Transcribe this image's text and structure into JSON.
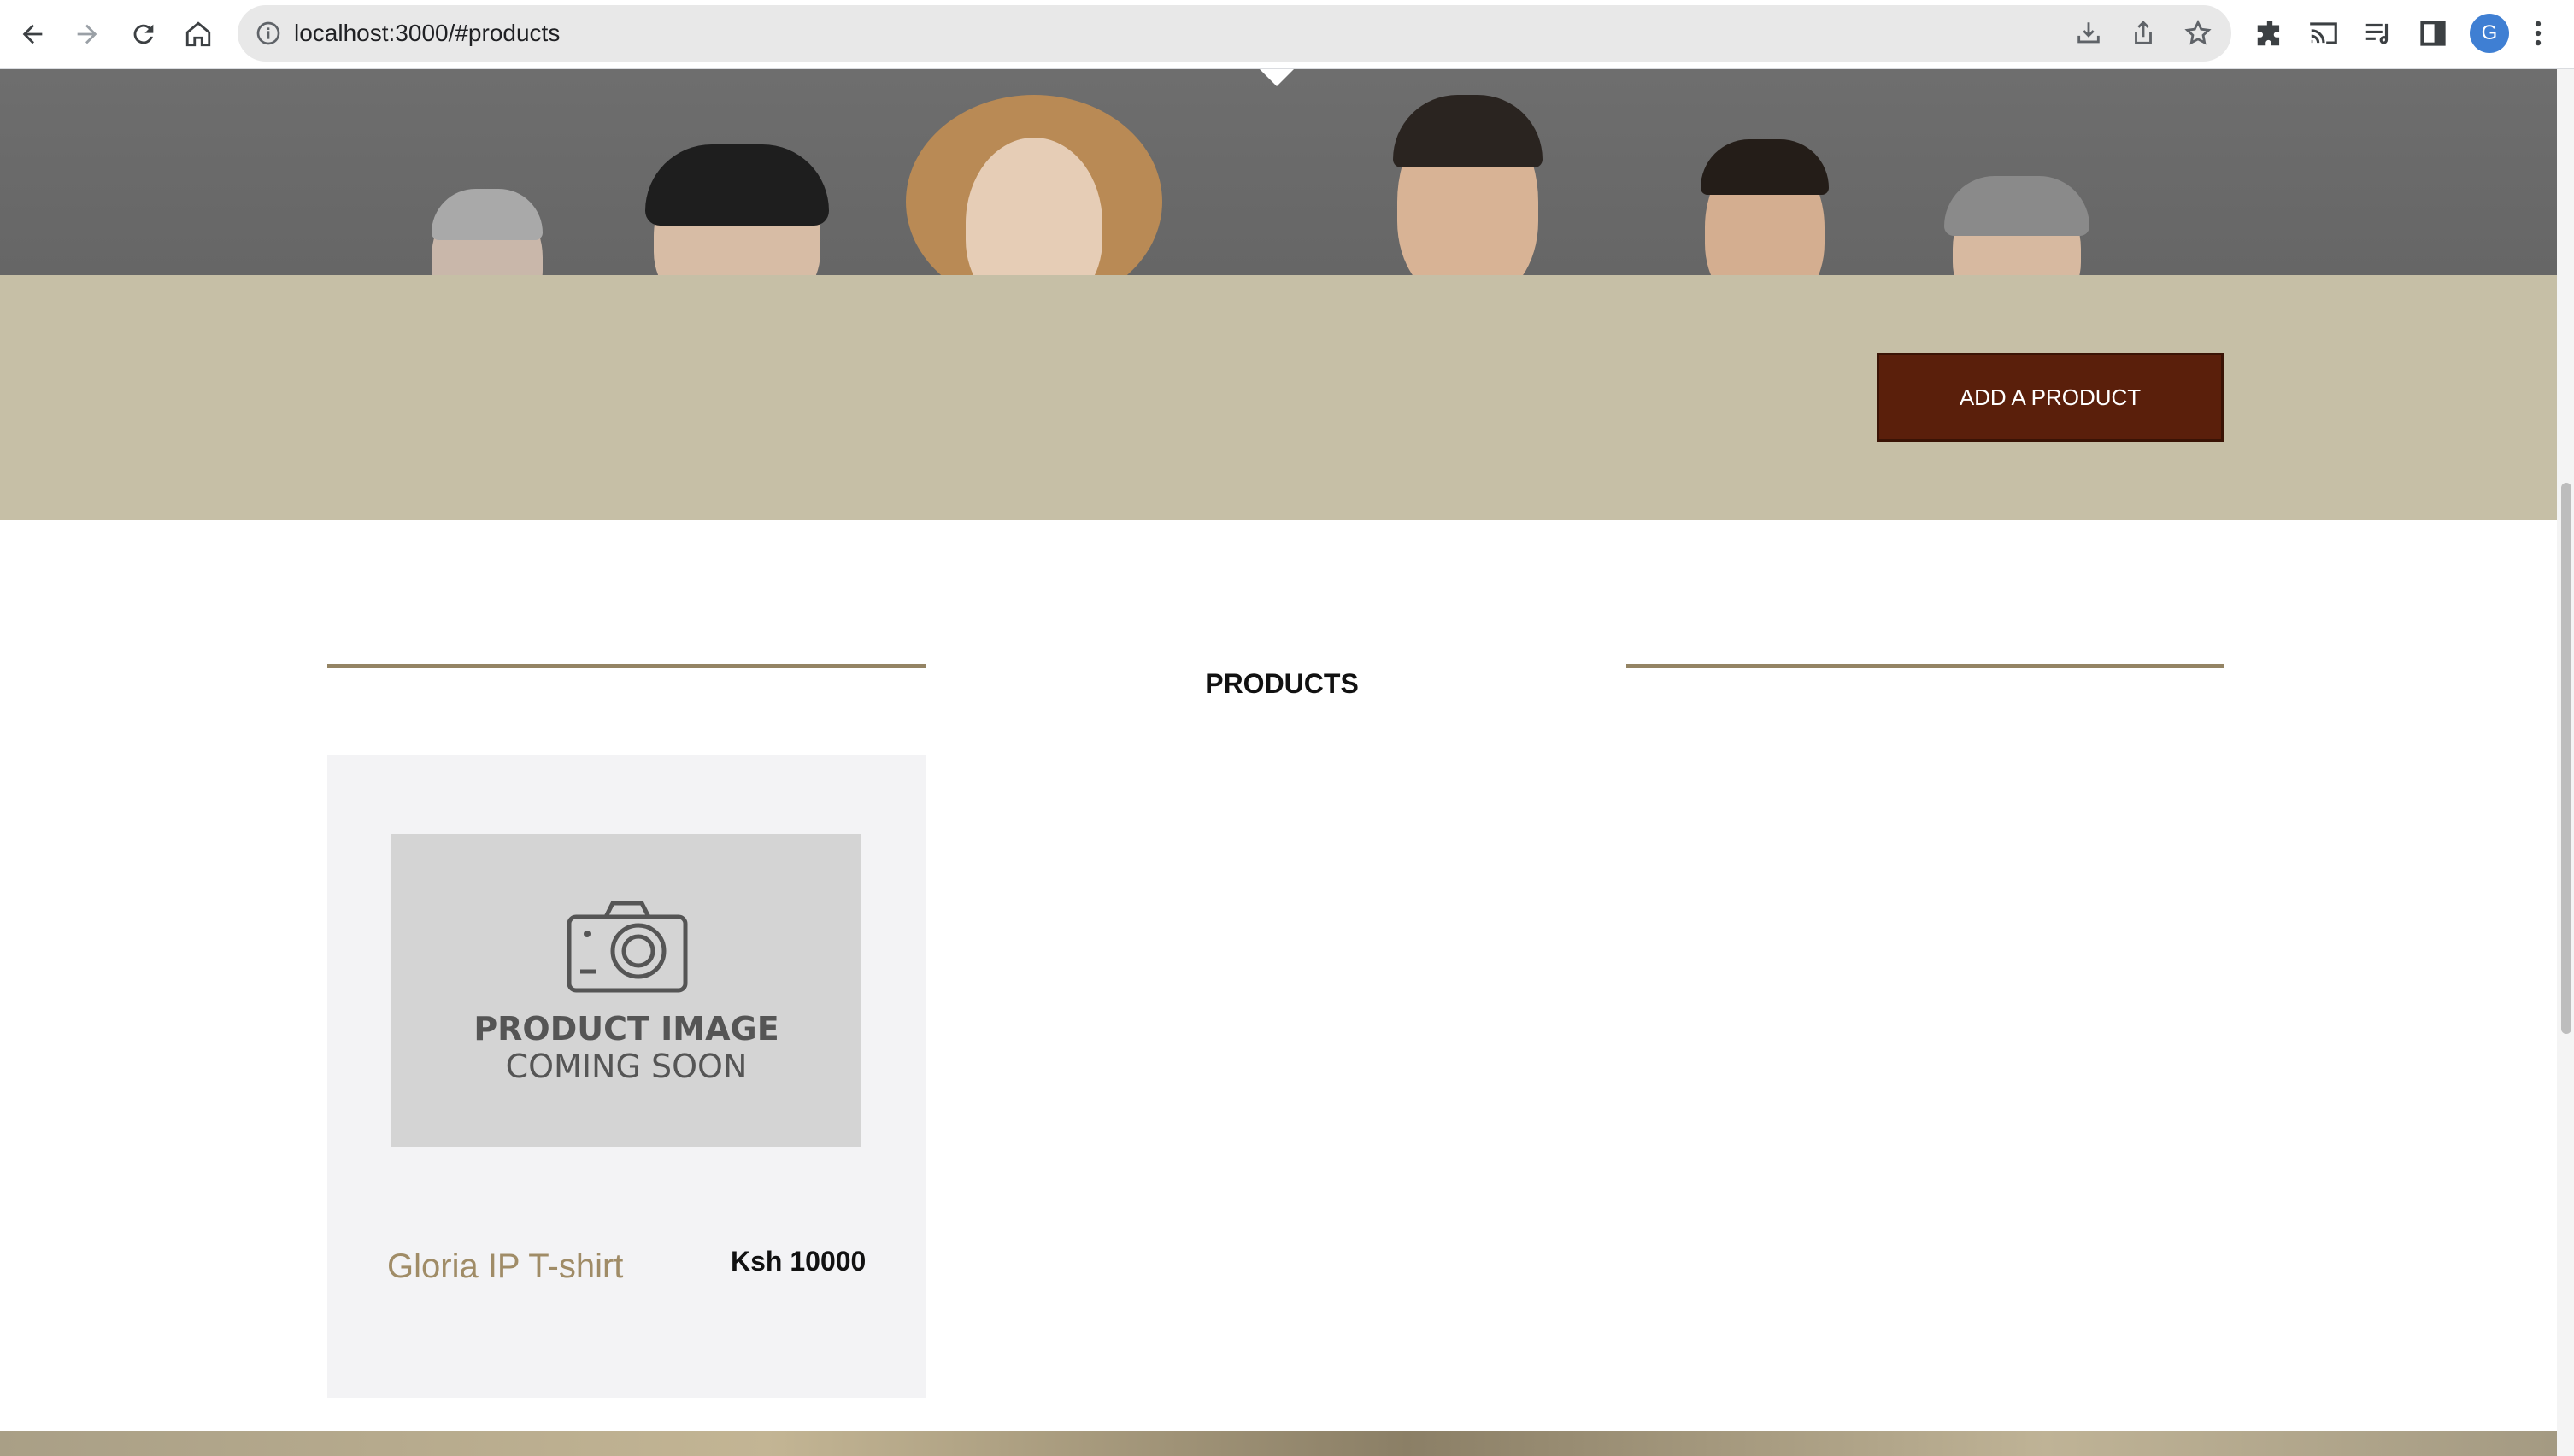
{
  "browser": {
    "url_host": "localhost",
    "url_rest": ":3000/#products",
    "avatar_letter": "G",
    "icons": [
      "back-icon",
      "forward-icon",
      "reload-icon",
      "home-icon",
      "info-icon",
      "install-icon",
      "share-icon",
      "star-icon",
      "extensions-icon",
      "cast-icon",
      "media-icon",
      "sidepanel-icon",
      "menu-icon"
    ]
  },
  "page": {
    "add_product_label": "ADD A PRODUCT",
    "section_title": "PRODUCTS",
    "products": [
      {
        "name": "Gloria IP T-shirt",
        "price": "Ksh 10000",
        "image_line1": "PRODUCT IMAGE",
        "image_line2": "COMING SOON"
      }
    ]
  },
  "colors": {
    "band": "#c6bfa6",
    "button": "#5a1f0b",
    "accent_line": "#948464",
    "product_name": "#a08c67",
    "card_bg": "#f3f3f5"
  }
}
